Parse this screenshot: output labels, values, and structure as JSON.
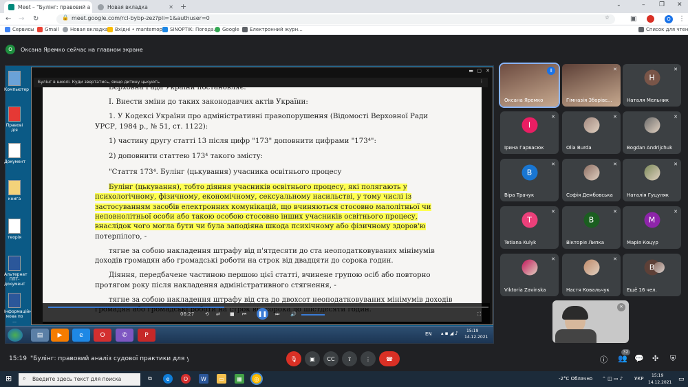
{
  "browser": {
    "tabs": [
      {
        "label": "Meet – \"Булінг: правовий а",
        "active": true
      },
      {
        "label": "Новая вкладка",
        "active": false
      }
    ],
    "new_tab": "+",
    "url": "meet.google.com/rcl-bybp-zez?pli=1&authuser=0",
    "bookmarks": [
      "Сервисы",
      "Gmail",
      "Новая вкладка",
      "Вхідні • mantemopi...",
      "SINOPTIK: Погода...",
      "Google",
      "Електронний журн..."
    ],
    "reading_list": "Список для чтения",
    "profile_initial": "O",
    "window_controls": {
      "minimize": "–",
      "maximize": "❐",
      "close": "✕"
    }
  },
  "meet": {
    "presenter": {
      "initial": "О",
      "text": "Оксана Яремко сейчас на главном экране"
    },
    "time": "15:19",
    "meeting_title": "\"Булінг: правовий аналіз судової практики для уч...",
    "people_badge": "32"
  },
  "shared_screen": {
    "desktop_icons": [
      "Компьютер",
      "Правові дія",
      "Документ",
      "книга",
      "теорія",
      "Альтернат ППТ-документ",
      "Інформаційна мова по ..."
    ],
    "player_title": "Булінг в школі. Куди звертатись, якщо дитину цькують",
    "document_lines": [
      {
        "text": "Верховна Рада України постановляє:",
        "indent": 96,
        "hl": false
      },
      {
        "text": "I. Внести зміни до таких законодавчих актів України:",
        "indent": 96,
        "hl": false
      },
      {
        "text": "1. У Кодексі України про адміністративні правопорушення (Відомості Верховної Ради",
        "indent": 96,
        "hl": false
      },
      {
        "text": "УРСР, 1984 р., № 51, ст. 1122):",
        "indent": 76,
        "hl": false
      },
      {
        "text": "1) частину другу статті 13 після цифр \"173\" доповнити цифрами \"173⁴\":",
        "indent": 96,
        "hl": false
      },
      {
        "text": "2) доповнити статтею 173⁴ такого змісту:",
        "indent": 96,
        "hl": false
      },
      {
        "text": "\"Стаття 173⁴. Булінг (цькування) учасника освітнього процесу",
        "indent": 96,
        "hl": false
      },
      {
        "text": "Булінг (цькування), тобто діяння учасників освітнього процесу, які полягають у",
        "indent": 96,
        "hl": true
      },
      {
        "text": "психологічному, фізичному, економічному, сексуальному насильстві, у тому числі із",
        "indent": 76,
        "hl": true
      },
      {
        "text": "застосуванням засобів електронних комунікацій, що вчиняються стосовно малолітньої чи",
        "indent": 76,
        "hl": true
      },
      {
        "text": "неповнолітньої особи або такою особою стосовно інших учасників освітнього процесу,",
        "indent": 76,
        "hl": true
      },
      {
        "text": "внаслідок чого могла бути чи була заподіяна шкода психічному або фізичному здоров'ю",
        "indent": 76,
        "hl": true
      },
      {
        "text": "потерпілого, -",
        "indent": 76,
        "hl": false
      },
      {
        "text": "тягне за собою накладення штрафу від п'ятдесяти до ста неоподатковуваних мінімумів",
        "indent": 96,
        "hl": false
      },
      {
        "text": "доходів громадян або громадські роботи на строк від двадцяти до сорока годин.",
        "indent": 76,
        "hl": false
      },
      {
        "text": "Діяння, передбачене частиною першою цієї статті, вчинене групою осіб або повторно",
        "indent": 96,
        "hl": false
      },
      {
        "text": "протягом року після накладення адміністративного стягнення, -",
        "indent": 76,
        "hl": false
      },
      {
        "text": "тягне за собою накладення штрафу від ста до двохсот неоподатковуваних мінімумів доходів",
        "indent": 96,
        "hl": false
      },
      {
        "text": "громадян або громадські роботи на строк від сорока до шістдесяти годин.",
        "indent": 76,
        "hl": false
      }
    ],
    "player_progress": 0.4,
    "player_time": "06:27",
    "w7_lang": "EN",
    "w7_time": "15:19",
    "w7_date": "14.12.2021"
  },
  "participants": [
    {
      "name": "Оксана Яремко",
      "initial": "",
      "color": "#6d4c41",
      "kind": "cam",
      "speaking": true
    },
    {
      "name": "Гімназія Зборівс...",
      "initial": "",
      "color": "#5d4037",
      "kind": "cam",
      "speaking": false
    },
    {
      "name": "Наталя Мельник",
      "initial": "Н",
      "color": "#795548",
      "kind": "initial",
      "speaking": false
    },
    {
      "name": "Ірина Гарвасюк",
      "initial": "I",
      "color": "#e91e63",
      "kind": "initial",
      "speaking": false
    },
    {
      "name": "Olia Burda",
      "initial": "",
      "color": "#a1887f",
      "kind": "photo",
      "speaking": false
    },
    {
      "name": "Bogdan Andrijchuk",
      "initial": "",
      "color": "#6d6d6d",
      "kind": "photo",
      "speaking": false
    },
    {
      "name": "Віра Трачук",
      "initial": "В",
      "color": "#1976d2",
      "kind": "initial",
      "speaking": false
    },
    {
      "name": "Софія Дембовська",
      "initial": "",
      "color": "#8d6e63",
      "kind": "photo",
      "speaking": false
    },
    {
      "name": "Наталія Гуцуляк",
      "initial": "",
      "color": "#7b8a5a",
      "kind": "photo",
      "speaking": false
    },
    {
      "name": "Tetiana Kulyk",
      "initial": "T",
      "color": "#ec407a",
      "kind": "initial",
      "speaking": false
    },
    {
      "name": "Вікторія Липка",
      "initial": "В",
      "color": "#1b5e20",
      "kind": "initial",
      "speaking": false
    },
    {
      "name": "Марія Коцур",
      "initial": "M",
      "color": "#8e24aa",
      "kind": "initial",
      "speaking": false
    },
    {
      "name": "Viktoria Zavinska",
      "initial": "",
      "color": "#c2185b",
      "kind": "photo",
      "speaking": false
    },
    {
      "name": "Настя Ковальчук",
      "initial": "",
      "color": "#bf8a6a",
      "kind": "photo",
      "speaking": false
    },
    {
      "name": "Ещё 16 чел.",
      "initial": "В",
      "color": "#5d4037",
      "kind": "more",
      "speaking": false
    }
  ],
  "w10": {
    "search_placeholder": "Введите здесь текст для поиска",
    "weather": "-2°C  Облачно",
    "lang": "УКР",
    "time": "15:19",
    "date": "14.12.2021"
  }
}
